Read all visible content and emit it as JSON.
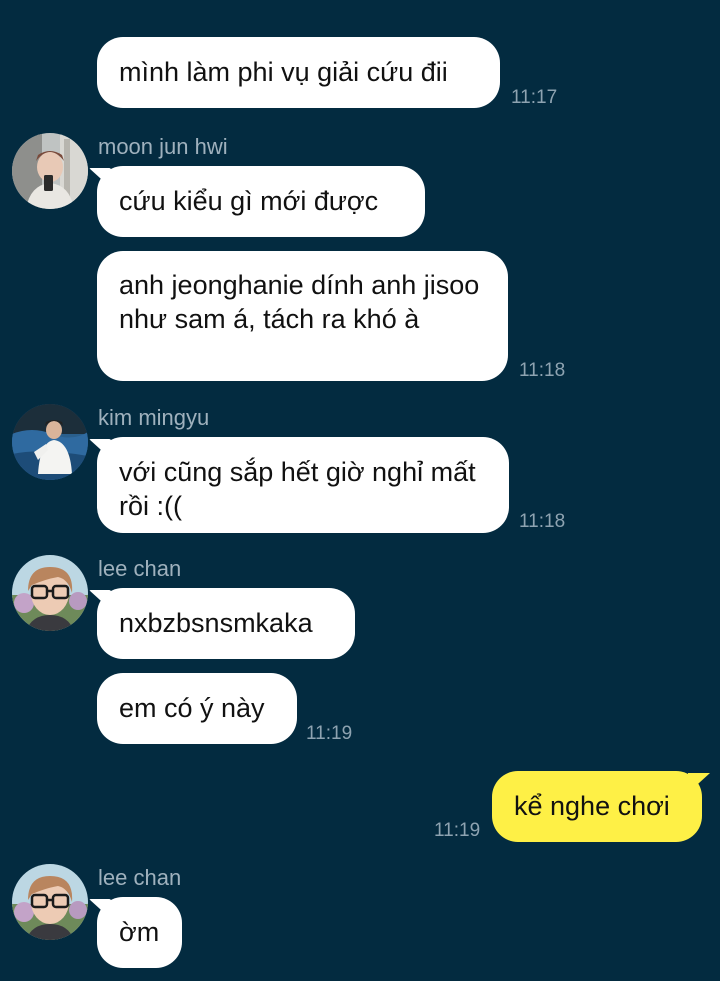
{
  "chat": {
    "messages": [
      {
        "text": "mình làm phi vụ giải cứu đii",
        "time": "11:17"
      },
      {
        "sender": "moon jun hwi",
        "text": "cứu kiểu gì mới được"
      },
      {
        "text": "anh jeonghanie dính anh jisoo như sam á, tách ra khó à",
        "time": "11:18"
      },
      {
        "sender": "kim mingyu",
        "text": "với cũng sắp hết giờ nghỉ mất rồi :((",
        "time": "11:18"
      },
      {
        "sender": "lee chan",
        "text": "nxbzbsnsmkaka"
      },
      {
        "text": "em có ý này",
        "time": "11:19"
      },
      {
        "text": "kể nghe chơi",
        "time": "11:19",
        "outgoing": true
      },
      {
        "sender": "lee chan",
        "text": "ờm"
      }
    ]
  },
  "colors": {
    "background": "#032b40",
    "incoming_bubble": "#ffffff",
    "outgoing_bubble": "#fef046",
    "timestamp": "#8ea3b1",
    "sender_name": "#9fb1bd"
  }
}
